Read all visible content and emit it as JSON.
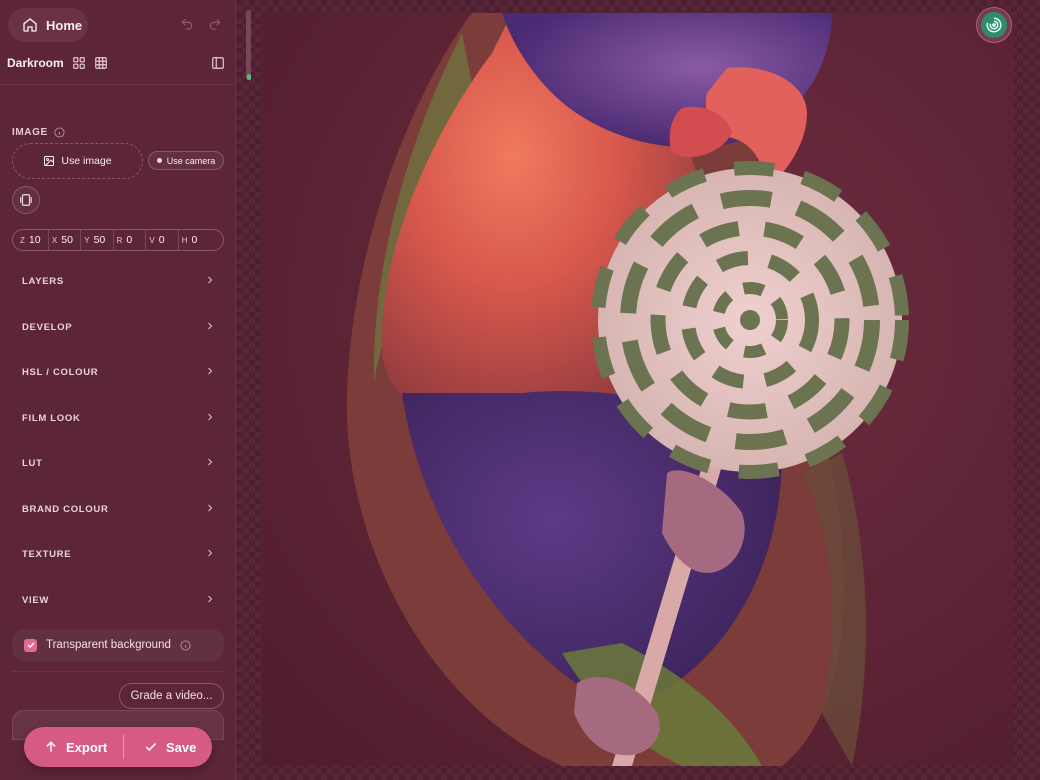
{
  "header": {
    "home_label": "Home",
    "workspace_title": "Darkroom"
  },
  "image_section": {
    "label": "IMAGE",
    "use_image_label": "Use image",
    "use_camera_label": "Use camera"
  },
  "transform": [
    {
      "key": "Z",
      "value": "10"
    },
    {
      "key": "X",
      "value": "50"
    },
    {
      "key": "Y",
      "value": "50"
    },
    {
      "key": "R",
      "value": "0"
    },
    {
      "key": "V",
      "value": "0"
    },
    {
      "key": "H",
      "value": "0"
    }
  ],
  "panels": [
    {
      "label": "LAYERS"
    },
    {
      "label": "DEVELOP"
    },
    {
      "label": "HSL / COLOUR"
    },
    {
      "label": "FILM LOOK"
    },
    {
      "label": "LUT"
    },
    {
      "label": "BRAND COLOUR"
    },
    {
      "label": "TEXTURE"
    },
    {
      "label": "VIEW"
    }
  ],
  "options": {
    "transparent_background_label": "Transparent background",
    "transparent_background_checked": true
  },
  "grade_video_label": "Grade a video...",
  "actions": {
    "export_label": "Export",
    "save_label": "Save"
  },
  "colors": {
    "accent": "#d65b84",
    "sidebar_bg": "#5c2638",
    "canvas_bg": "#5d2435",
    "status_green": "#49c37a"
  }
}
